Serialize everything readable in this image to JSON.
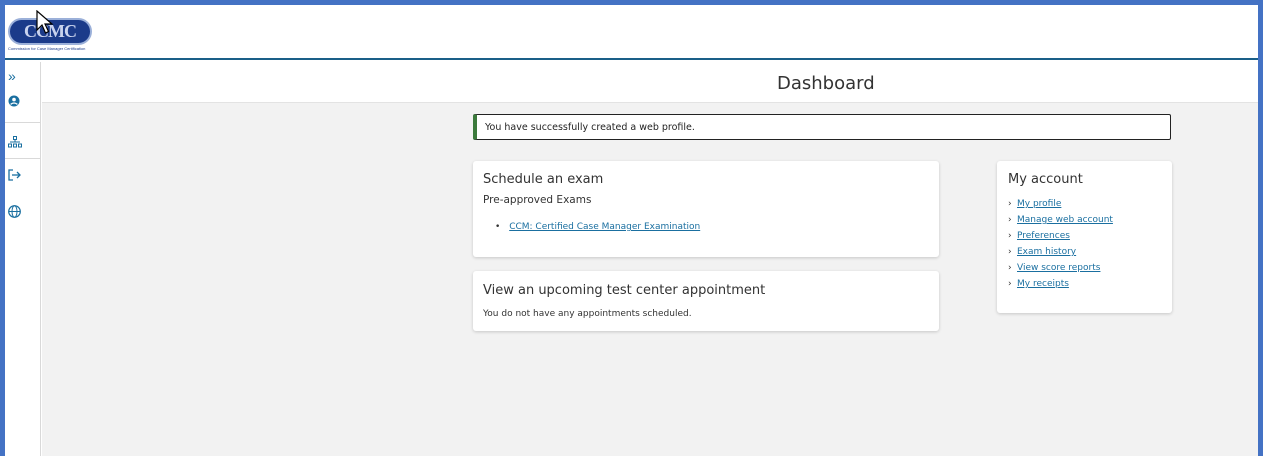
{
  "logo": {
    "text": "CCMC",
    "subtitle": "Commission for Case Manager Certification"
  },
  "sidebar": {
    "items": [
      {
        "icon": "double-chevron-right-icon",
        "glyph": "»"
      },
      {
        "icon": "user-icon",
        "glyph": "●"
      },
      {
        "icon": "sitemap-icon",
        "glyph": "⊞"
      },
      {
        "icon": "sign-out-icon",
        "glyph": "↪"
      },
      {
        "icon": "globe-icon",
        "glyph": "⊕"
      }
    ]
  },
  "header": {
    "title": "Dashboard"
  },
  "alert": {
    "message": "You have successfully created a web profile."
  },
  "schedule": {
    "title": "Schedule an exam",
    "subtitle": "Pre-approved Exams",
    "exams": [
      "CCM: Certified Case Manager Examination"
    ]
  },
  "appointment": {
    "title": "View an upcoming test center appointment",
    "message": "You do not have any appointments scheduled."
  },
  "account": {
    "title": "My account",
    "links": [
      "My profile",
      "Manage web account",
      "Preferences",
      "Exam history",
      "View score reports",
      "My receipts"
    ]
  },
  "colors": {
    "frame": "#4472c4",
    "topbar_border": "#1a5f88",
    "link": "#1a6fa0",
    "alert_accent": "#3c7a3c",
    "background": "#f2f2f2"
  }
}
